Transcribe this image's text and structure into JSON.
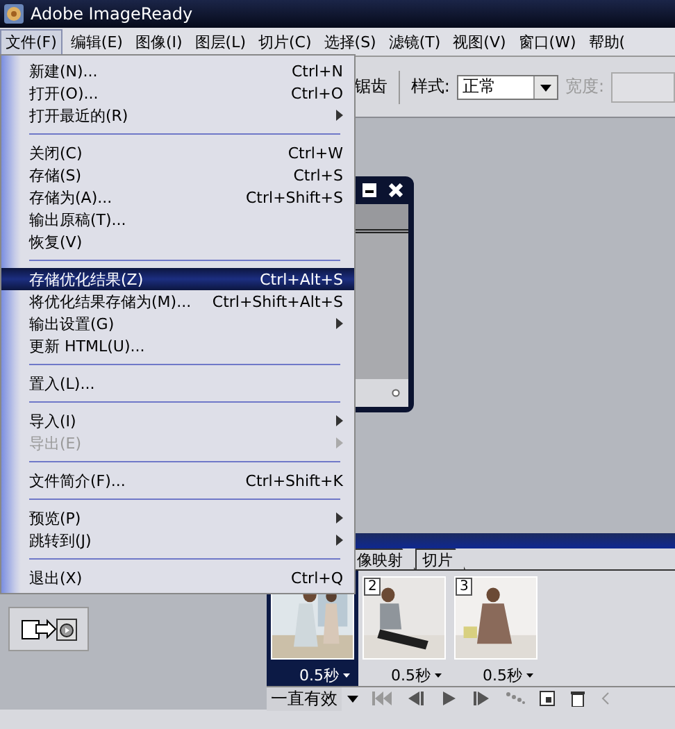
{
  "title": "Adobe ImageReady",
  "menubar": [
    {
      "label": "文件(F)",
      "selected": true
    },
    {
      "label": "编辑(E)",
      "selected": false
    },
    {
      "label": "图像(I)",
      "selected": false
    },
    {
      "label": "图层(L)",
      "selected": false
    },
    {
      "label": "切片(C)",
      "selected": false
    },
    {
      "label": "选择(S)",
      "selected": false
    },
    {
      "label": "滤镜(T)",
      "selected": false
    },
    {
      "label": "视图(V)",
      "selected": false
    },
    {
      "label": "窗口(W)",
      "selected": false
    },
    {
      "label": "帮助(",
      "selected": false
    }
  ],
  "toolbar": {
    "antialias_label": "锯齿",
    "style_label": "样式:",
    "style_value": "正常",
    "width_label": "宽度:"
  },
  "file_menu": [
    {
      "kind": "item",
      "label": "新建(N)...",
      "shortcut": "Ctrl+N",
      "submenu": false,
      "disabled": false,
      "selected": false
    },
    {
      "kind": "item",
      "label": "打开(O)...",
      "shortcut": "Ctrl+O",
      "submenu": false,
      "disabled": false,
      "selected": false
    },
    {
      "kind": "item",
      "label": "打开最近的(R)",
      "submenu": true,
      "disabled": false,
      "selected": false
    },
    {
      "kind": "separator"
    },
    {
      "kind": "item",
      "label": "关闭(C)",
      "shortcut": "Ctrl+W",
      "submenu": false,
      "disabled": false,
      "selected": false
    },
    {
      "kind": "item",
      "label": "存储(S)",
      "shortcut": "Ctrl+S",
      "submenu": false,
      "disabled": false,
      "selected": false
    },
    {
      "kind": "item",
      "label": "存储为(A)...",
      "shortcut": "Ctrl+Shift+S",
      "submenu": false,
      "disabled": false,
      "selected": false
    },
    {
      "kind": "item",
      "label": "输出原稿(T)...",
      "submenu": false,
      "disabled": false,
      "selected": false
    },
    {
      "kind": "item",
      "label": "恢复(V)",
      "submenu": false,
      "disabled": false,
      "selected": false
    },
    {
      "kind": "separator"
    },
    {
      "kind": "item",
      "label": "存储优化结果(Z)",
      "shortcut": "Ctrl+Alt+S",
      "submenu": false,
      "disabled": false,
      "selected": true
    },
    {
      "kind": "item",
      "label": "将优化结果存储为(M)...",
      "shortcut": "Ctrl+Shift+Alt+S",
      "submenu": false,
      "disabled": false,
      "selected": false
    },
    {
      "kind": "item",
      "label": "输出设置(G)",
      "submenu": true,
      "disabled": false,
      "selected": false
    },
    {
      "kind": "item",
      "label": "更新 HTML(U)...",
      "submenu": false,
      "disabled": false,
      "selected": false
    },
    {
      "kind": "separator"
    },
    {
      "kind": "item",
      "label": "置入(L)...",
      "submenu": false,
      "disabled": false,
      "selected": false
    },
    {
      "kind": "separator"
    },
    {
      "kind": "item",
      "label": "导入(I)",
      "submenu": true,
      "disabled": false,
      "selected": false
    },
    {
      "kind": "item",
      "label": "导出(E)",
      "submenu": true,
      "disabled": true,
      "selected": false
    },
    {
      "kind": "separator"
    },
    {
      "kind": "item",
      "label": "文件简介(F)...",
      "shortcut": "Ctrl+Shift+K",
      "submenu": false,
      "disabled": false,
      "selected": false
    },
    {
      "kind": "separator"
    },
    {
      "kind": "item",
      "label": "预览(P)",
      "submenu": true,
      "disabled": false,
      "selected": false
    },
    {
      "kind": "item",
      "label": "跳转到(J)",
      "submenu": true,
      "disabled": false,
      "selected": false
    },
    {
      "kind": "separator"
    },
    {
      "kind": "item",
      "label": "退出(X)",
      "shortcut": "Ctrl+Q",
      "submenu": false,
      "disabled": false,
      "selected": false
    }
  ],
  "animation": {
    "tabs": [
      {
        "label": "像映射",
        "selected": false
      },
      {
        "label": "切片",
        "selected": false
      }
    ],
    "frames": [
      {
        "delay": "0.5秒",
        "selected": true
      },
      {
        "number": "2",
        "delay": "0.5秒",
        "selected": false
      },
      {
        "number": "3",
        "delay": "0.5秒",
        "selected": false
      }
    ],
    "loop": "一直有效"
  }
}
